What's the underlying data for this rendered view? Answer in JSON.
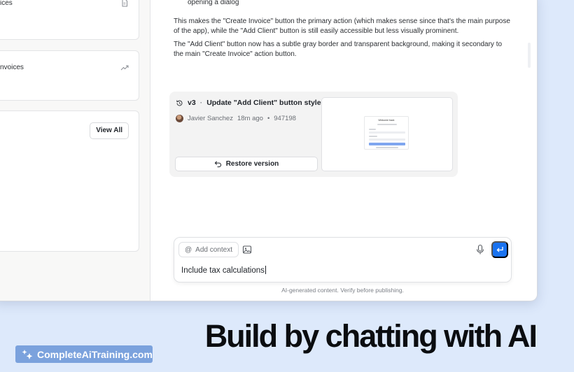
{
  "left_panel": {
    "card1_title": "ices",
    "card1_icon": "document-icon",
    "card2_title": "nvoices",
    "card2_icon": "trend-up-icon",
    "card3_button": "View All"
  },
  "chat": {
    "bullet_text": "opening a dialog",
    "paragraph1": "This makes the \"Create Invoice\" button the primary action (which makes sense since that's the main purpose of the app), while the \"Add Client\" button is still easily accessible but less visually prominent.",
    "paragraph2": "The \"Add Client\" button now has a subtle gray border and transparent background, making it secondary to the main \"Create Invoice\" action button."
  },
  "version_card": {
    "version": "v3",
    "separator": "·",
    "title": "Update \"Add Client\" button style",
    "author": "Javier Sanchez",
    "time_ago": "18m ago",
    "meta_separator": "•",
    "commit": "947198",
    "restore_label": "Restore version",
    "thumbnail_heading": "Welcome back"
  },
  "composer": {
    "add_context_label": "Add context",
    "input_value": "Include tax calculations",
    "disclaimer": "AI-generated content. Verify before publishing."
  },
  "promo": {
    "headline": "Build by chatting with AI",
    "brand": "CompleteAiTraining.com"
  },
  "colors": {
    "background": "#dde9fb",
    "accent": "#1a73f0",
    "brand_badge": "#7ba2dd"
  }
}
